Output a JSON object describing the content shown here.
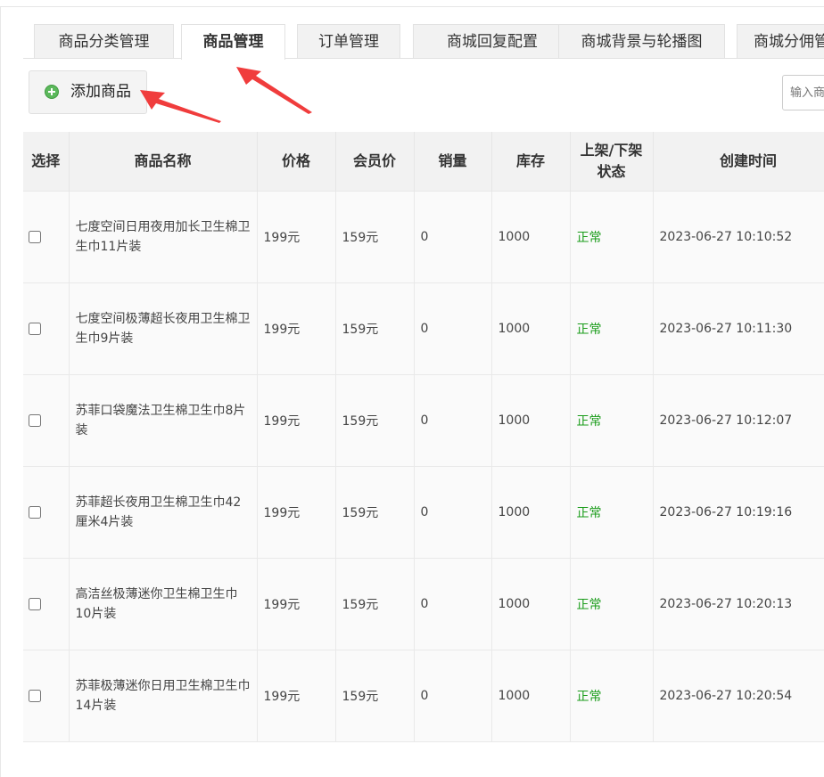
{
  "tabs": [
    {
      "label": "商品分类管理",
      "active": false
    },
    {
      "label": "商品管理",
      "active": true
    },
    {
      "label": "订单管理",
      "active": false
    },
    {
      "label": "商城回复配置",
      "active": false
    },
    {
      "label": "商城背景与轮播图",
      "active": false
    },
    {
      "label": "商城分佣管理",
      "active": false
    }
  ],
  "toolbar": {
    "add_label": "添加商品",
    "search_placeholder": "输入商"
  },
  "table": {
    "headers": {
      "select": "选择",
      "name": "商品名称",
      "price": "价格",
      "member_price": "会员价",
      "sales": "销量",
      "stock": "库存",
      "status_line1": "上架/下架",
      "status_line2": "状态",
      "created": "创建时间"
    },
    "rows": [
      {
        "name": "七度空间日用夜用加长卫生棉卫生巾11片装",
        "price": "199元",
        "member_price": "159元",
        "sales": "0",
        "stock": "1000",
        "status": "正常",
        "created": "2023-06-27 10:10:52"
      },
      {
        "name": "七度空间极薄超长夜用卫生棉卫生巾9片装",
        "price": "199元",
        "member_price": "159元",
        "sales": "0",
        "stock": "1000",
        "status": "正常",
        "created": "2023-06-27 10:11:30"
      },
      {
        "name": "苏菲口袋魔法卫生棉卫生巾8片装",
        "price": "199元",
        "member_price": "159元",
        "sales": "0",
        "stock": "1000",
        "status": "正常",
        "created": "2023-06-27 10:12:07"
      },
      {
        "name": "苏菲超长夜用卫生棉卫生巾42厘米4片装",
        "price": "199元",
        "member_price": "159元",
        "sales": "0",
        "stock": "1000",
        "status": "正常",
        "created": "2023-06-27 10:19:16"
      },
      {
        "name": "高洁丝极薄迷你卫生棉卫生巾10片装",
        "price": "199元",
        "member_price": "159元",
        "sales": "0",
        "stock": "1000",
        "status": "正常",
        "created": "2023-06-27 10:20:13"
      },
      {
        "name": "苏菲极薄迷你日用卫生棉卫生巾14片装",
        "price": "199元",
        "member_price": "159元",
        "sales": "0",
        "stock": "1000",
        "status": "正常",
        "created": "2023-06-27 10:20:54"
      }
    ]
  },
  "colors": {
    "status_ok": "#1a9c1a",
    "annotation_arrow": "#f03c3c",
    "add_icon": "#5cb85c"
  },
  "icons": {
    "add": "plus-circle-icon",
    "annotation": "red-arrow-icon"
  }
}
